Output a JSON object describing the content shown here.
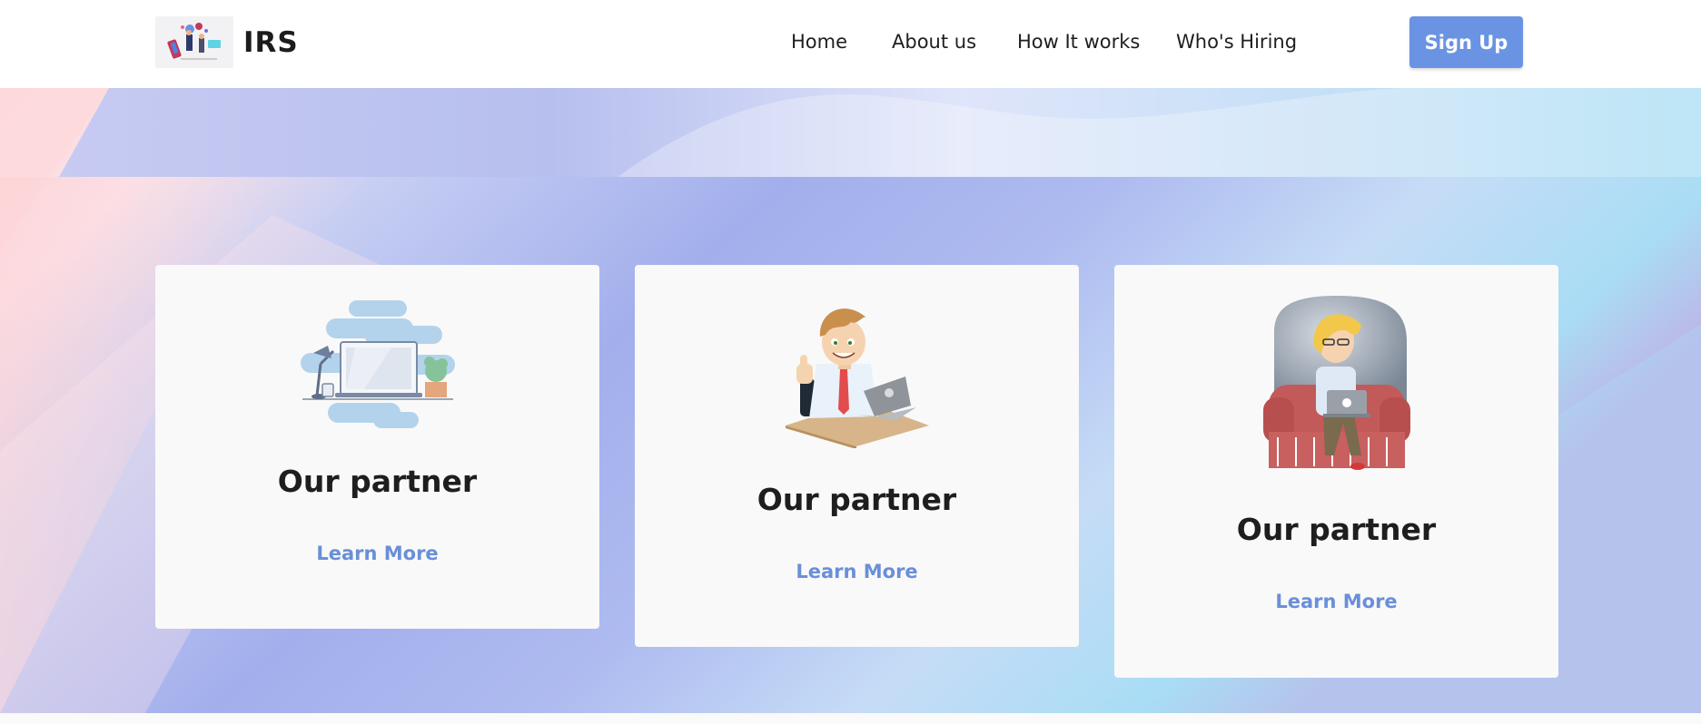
{
  "brand": {
    "name": "IRS"
  },
  "nav": {
    "links": [
      {
        "label": "Home"
      },
      {
        "label": "About us"
      },
      {
        "label": "How It works"
      },
      {
        "label": "Who's Hiring"
      }
    ],
    "signup_label": "Sign Up"
  },
  "partners": [
    {
      "title": "Our partner",
      "link_label": "Learn More",
      "illustration": "workspace-laptop-illustration"
    },
    {
      "title": "Our partner",
      "link_label": "Learn More",
      "illustration": "businessman-laptop-thumbs-up-illustration"
    },
    {
      "title": "Our partner",
      "link_label": "Learn More",
      "illustration": "woman-armchair-laptop-illustration"
    }
  ],
  "colors": {
    "accent": "#6a93e3",
    "link": "#6a8fd9",
    "card_bg": "#f9f9f9",
    "hero_pink": "#fcd7dc",
    "hero_periwinkle": "#a4b0ec",
    "hero_cyan": "#a8def5"
  }
}
